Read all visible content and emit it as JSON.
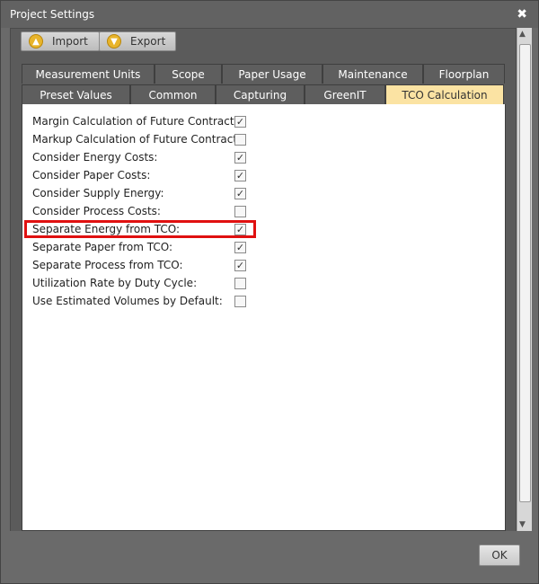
{
  "window": {
    "title": "Project Settings",
    "close_glyph": "✖"
  },
  "toolbar": {
    "import": {
      "label": "Import",
      "icon": "arrow-up-circle-icon"
    },
    "export": {
      "label": "Export",
      "icon": "arrow-down-circle-icon"
    }
  },
  "tabs_top": [
    "Measurement Units",
    "Scope",
    "Paper Usage",
    "Maintenance",
    "Floorplan"
  ],
  "tabs_bottom": [
    "Preset Values",
    "Common",
    "Capturing",
    "GreenIT",
    "TCO Calculation"
  ],
  "active_tab": "TCO Calculation",
  "settings": [
    {
      "label": "Margin Calculation of Future Contracts:",
      "checked": true
    },
    {
      "label": "Markup Calculation of Future Contracts:",
      "checked": false
    },
    {
      "label": "Consider Energy Costs:",
      "checked": true
    },
    {
      "label": "Consider Paper Costs:",
      "checked": true
    },
    {
      "label": "Consider Supply Energy:",
      "checked": true
    },
    {
      "label": "Consider Process Costs:",
      "checked": false
    },
    {
      "label": "Separate Energy from TCO:",
      "checked": true,
      "highlighted": true
    },
    {
      "label": "Separate Paper from TCO:",
      "checked": true
    },
    {
      "label": "Separate Process from TCO:",
      "checked": true
    },
    {
      "label": "Utilization Rate by Duty Cycle:",
      "checked": false
    },
    {
      "label": "Use Estimated Volumes by Default:",
      "checked": false
    }
  ],
  "footer": {
    "ok_label": "OK"
  },
  "colors": {
    "active_tab": "#fbe3a3",
    "highlight": "#e01010",
    "icon_accent": "#e8b42a"
  }
}
